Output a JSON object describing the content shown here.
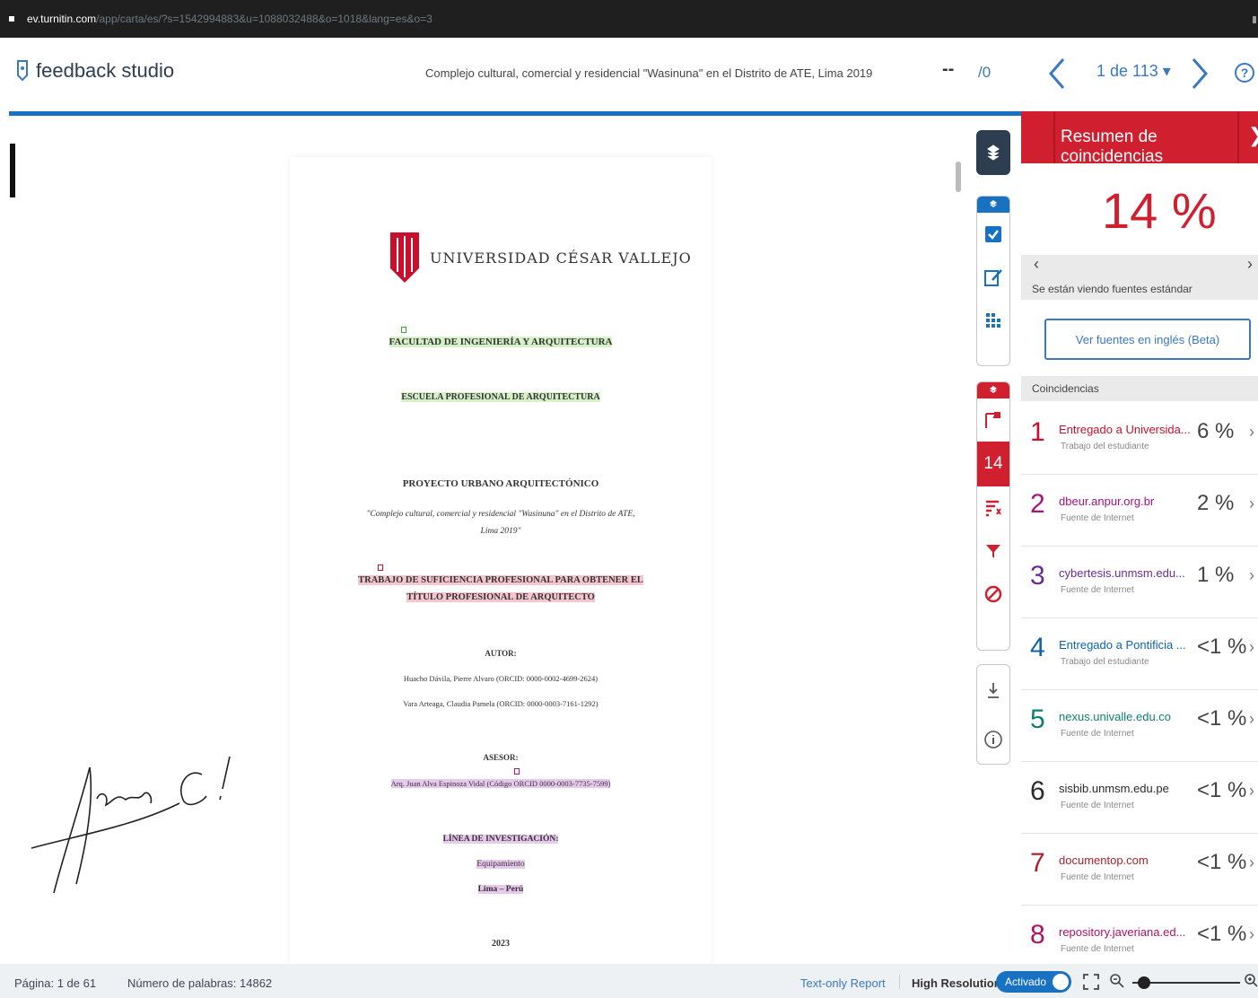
{
  "browser": {
    "domain": "ev.turnitin.com",
    "path": "/app/carta/es/?s=1542994883&u=1088032488&o=1018&lang=es&o=3"
  },
  "header": {
    "brand": "feedback studio",
    "document_title": "Complejo cultural, comercial y residencial \"Wasinuna\" en el Distrito de ATE, Lima 2019",
    "ellipsis": "--",
    "count": "/0",
    "page_selector": "1 de 113 ▾"
  },
  "document": {
    "university": "UNIVERSIDAD CÉSAR VALLEJO",
    "faculty": "FACULTAD DE INGENIERÍA Y ARQUITECTURA",
    "school": "ESCUELA PROFESIONAL DE ARQUITECTURA",
    "project": "PROYECTO URBANO ARQUITECTÓNICO",
    "project_title_1": "\"Complejo cultural, comercial y residencial \"Wasinuna\" en el Distrito de ATE,",
    "project_title_2": "Lima 2019\"",
    "degree_1": "TRABAJO DE SUFICIENCIA PROFESIONAL PARA OBTENER EL",
    "degree_2": "TÍTULO PROFESIONAL DE ARQUITECTO",
    "author_label": "AUTOR:",
    "author_1": "Huacho Dávila, Pierre Alvaro (ORCID: 0000-0002-4699-2624)",
    "author_2": "Vara Arteaga, Claudia Pamela (ORCID: 0000-0003-7161-1292)",
    "advisor_label": "ASESOR:",
    "advisor": "Arq. Juan Alva Espinoza Vidal (Código ORCID 0000-0003-7735-7599)",
    "research_label": "LÍNEA DE INVESTIGACIÓN:",
    "research": "Equipamiento",
    "city": "Lima – Perú",
    "year": "2023"
  },
  "toolbar": {
    "similarity_badge": "14"
  },
  "sidebar": {
    "title": "Resumen de coincidencias",
    "close": "❯",
    "percentage": "14 %",
    "source_mode": "Se están viendo fuentes estándar",
    "english_button": "Ver fuentes en inglés (Beta)",
    "matches_header": "Coincidencias",
    "matches": [
      {
        "num": "1",
        "name": "Entregado a Universida...",
        "type": "Trabajo del estudiante",
        "pct": "6 %"
      },
      {
        "num": "2",
        "name": "dbeur.anpur.org.br",
        "type": "Fuente de Internet",
        "pct": "2 %"
      },
      {
        "num": "3",
        "name": "cybertesis.unmsm.edu...",
        "type": "Fuente de Internet",
        "pct": "1 %"
      },
      {
        "num": "4",
        "name": "Entregado a Pontificia ...",
        "type": "Trabajo del estudiante",
        "pct": "<1 %"
      },
      {
        "num": "5",
        "name": "nexus.univalle.edu.co",
        "type": "Fuente de Internet",
        "pct": "<1 %"
      },
      {
        "num": "6",
        "name": "sisbib.unmsm.edu.pe",
        "type": "Fuente de Internet",
        "pct": "<1 %"
      },
      {
        "num": "7",
        "name": "documentop.com",
        "type": "Fuente de Internet",
        "pct": "<1 %"
      },
      {
        "num": "8",
        "name": "repository.javeriana.ed...",
        "type": "Fuente de Internet",
        "pct": "<1 %"
      }
    ],
    "match_colors": [
      "#c8102e",
      "#a3157f",
      "#6a2c91",
      "#0c64a8",
      "#0f7f6e",
      "#2b2b2b",
      "#a82330",
      "#b0125e"
    ]
  },
  "status": {
    "page": "Página: 1 de 61",
    "words": "Número de palabras: 14862",
    "text_only": "Text-only Report",
    "high_res": "High Resolution",
    "toggle": "Activado"
  }
}
